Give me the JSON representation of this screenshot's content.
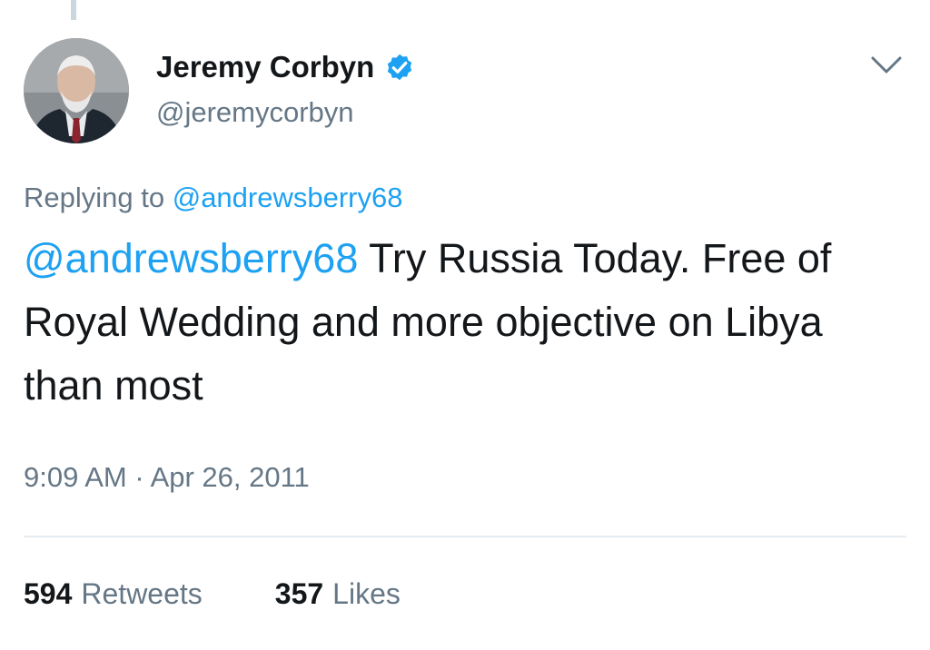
{
  "tweet": {
    "author": {
      "display_name": "Jeremy Corbyn",
      "handle": "@jeremycorbyn",
      "verified": true
    },
    "replying_to": {
      "prefix": "Replying to",
      "mention": "@andrewsberry68"
    },
    "text": {
      "mention": "@andrewsberry68",
      "body": "Try Russia Today. Free of Royal Wedding and more objective on Libya than most"
    },
    "timestamp": "9:09 AM · Apr 26, 2011",
    "stats": {
      "retweets_count": "594",
      "retweets_label": "Retweets",
      "likes_count": "357",
      "likes_label": "Likes"
    }
  },
  "colors": {
    "link": "#1da1f2",
    "secondary_text": "#657786",
    "primary_text": "#14171a",
    "divider": "#e6ecf0"
  },
  "icons": {
    "verified": "verified-badge-icon",
    "menu": "chevron-down-icon"
  }
}
